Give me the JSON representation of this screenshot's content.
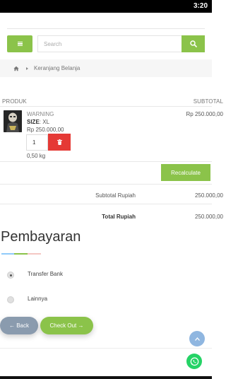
{
  "status_bar": {
    "time": "3:20"
  },
  "header": {
    "search_placeholder": "Search",
    "icons": {
      "menu": "menu-icon",
      "search": "search-icon"
    }
  },
  "breadcrumb": {
    "home_icon": "home-icon",
    "current": "Keranjang Belanja"
  },
  "cart": {
    "columns": [
      "PRODUK",
      "SUBTOTAL"
    ],
    "items": [
      {
        "name": "WARNING",
        "size_label": "SIZE",
        "size_value": ": XL",
        "price": "Rp 250.000,00",
        "quantity": "1",
        "weight": "0,50 kg",
        "subtotal": "Rp 250.000,00"
      }
    ],
    "recalculate_label": "Recalculate",
    "subtotal_label": "Subtotal Rupiah",
    "subtotal_value": "250.000,00",
    "total_label": "Total Rupiah",
    "total_value": "250.000,00"
  },
  "payment": {
    "title": "Pembayaran",
    "accent_colors": [
      "#90caf9",
      "#8bc34a",
      "#f4c7c3"
    ],
    "options": [
      {
        "label": "Transfer Bank",
        "selected": true
      },
      {
        "label": "Lainnya",
        "selected": false
      }
    ]
  },
  "actions": {
    "back_label": "← Back",
    "checkout_label": "Check Out →"
  },
  "colors": {
    "primary": "#8bc34a",
    "danger": "#e53935",
    "back": "#8a9bae",
    "scrolltop": "#8fb6e0",
    "whatsapp": "#25d366"
  }
}
